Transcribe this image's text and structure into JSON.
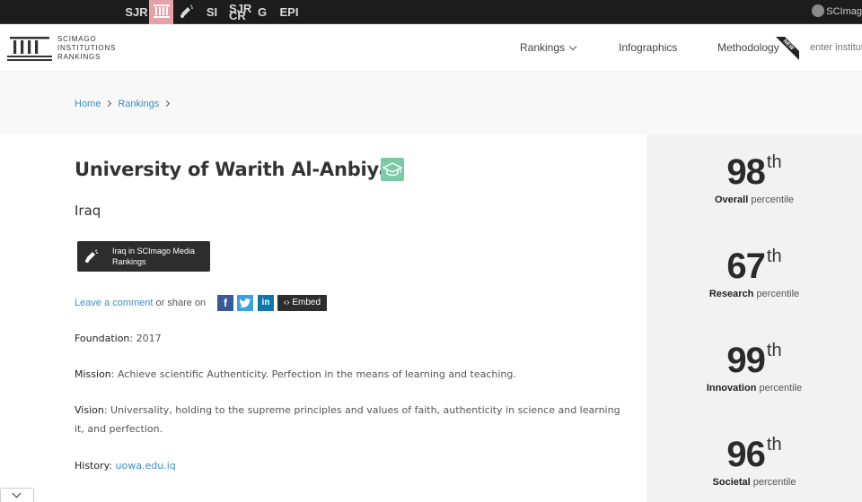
{
  "topbar": {
    "sites": {
      "sjr": "SJR",
      "si": "SI",
      "sjrcr_top": "SJR",
      "sjrcr_bottom": "CR",
      "g": "G",
      "epi": "EPI"
    },
    "corner_label": "SCImag",
    "active_color": "#e8a0a8"
  },
  "header": {
    "logo_lines": [
      "SCIMAGO",
      "INSTITUTIONS",
      "RANKINGS"
    ],
    "nav": {
      "rankings": "Rankings",
      "infographics": "Infographics",
      "methodology": "Methodology",
      "new_badge": "NEW"
    },
    "search_placeholder": "enter institution name"
  },
  "breadcrumb": {
    "home": "Home",
    "rankings": "Rankings"
  },
  "institution": {
    "name": "University of Warith Al-Anbiyaa",
    "country": "Iraq",
    "media_button": [
      "Iraq in SCImago Media",
      "Rankings"
    ],
    "share": {
      "comment_link": "Leave a comment",
      "share_text": " or share on ",
      "embed_label": "Embed"
    },
    "fields": {
      "foundation_label": "Foundation",
      "foundation_value": ": 2017",
      "mission_label": "Mission",
      "mission_value": ": Achieve scientific Authenticity. Perfection in the means of learning and teaching.",
      "vision_label": "Vision",
      "vision_value": ": Universality, holding to the supreme principles and values of faith, authenticity in science and learning it, and perfection.",
      "history_label": "History",
      "history_sep": ": ",
      "history_link": "uowa.edu.iq"
    }
  },
  "percentiles": [
    {
      "value": "98",
      "suffix": "th",
      "label": "Overall",
      "tail": " percentile"
    },
    {
      "value": "67",
      "suffix": "th",
      "label": "Research",
      "tail": " percentile"
    },
    {
      "value": "99",
      "suffix": "th",
      "label": "Innovation",
      "tail": " percentile"
    },
    {
      "value": "96",
      "suffix": "th",
      "label": "Societal",
      "tail": " percentile"
    }
  ],
  "colors": {
    "link": "#3c8fc4",
    "cap_badge": "#7cc9a6",
    "facebook": "#3b5998",
    "twitter": "#3da1dd",
    "linkedin": "#0e76a8"
  }
}
